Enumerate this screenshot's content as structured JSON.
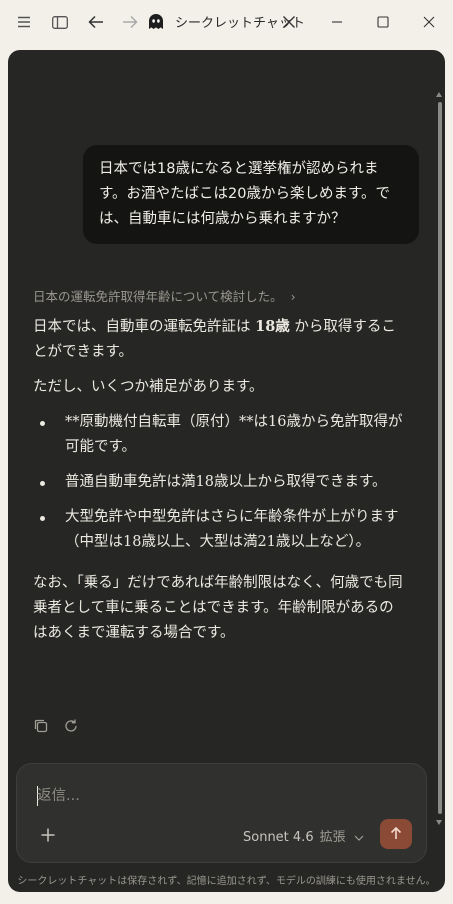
{
  "window": {
    "title": "シークレットチャット"
  },
  "conversation": {
    "user_message": "日本では18歳になると選挙権が認められます。お酒やたばこは20歳から楽しめます。では、自動車には何歳から乗れますか？",
    "thinking_summary": "日本の運転免許取得年齢について検討した。",
    "thinking_chevron": "›",
    "assistant": {
      "para1_before": "日本では、自動車の運転免許証は ",
      "para1_bold": "18歳",
      "para1_after": " から取得することができます。",
      "para2": "ただし、いくつか補足があります。",
      "bullets": [
        "**原動機付自転車（原付）**は16歳から免許取得が可能です。",
        "普通自動車免許は満18歳以上から取得できます。",
        "大型免許や中型免許はさらに年齢条件が上がります（中型は18歳以上、大型は満21歳以上など）。"
      ],
      "para3": "なお、「乗る」だけであれば年齢制限はなく、何歳でも同乗者として車に乗ることはできます。年齢制限があるのはあくまで運転する場合です。"
    }
  },
  "composer": {
    "placeholder": "返信...",
    "model_name": "Sonnet 4.6",
    "extended_label": "拡張",
    "send_color": "#8a4a35"
  },
  "footer": {
    "notice": "シークレットチャットは保存されず、記憶に追加されず、モデルの訓練にも使用されません。"
  },
  "icons": {
    "menu": "hamburger-icon",
    "sidebar": "sidebar-icon",
    "back": "back-arrow-icon",
    "forward": "forward-arrow-icon",
    "ghost": "ghost-icon",
    "close_chat": "close-icon",
    "minimize": "minimize-icon",
    "maximize": "maximize-icon",
    "close_window": "window-close-icon",
    "copy": "copy-icon",
    "retry": "retry-icon",
    "plus": "plus-icon",
    "send": "arrow-up-icon"
  }
}
